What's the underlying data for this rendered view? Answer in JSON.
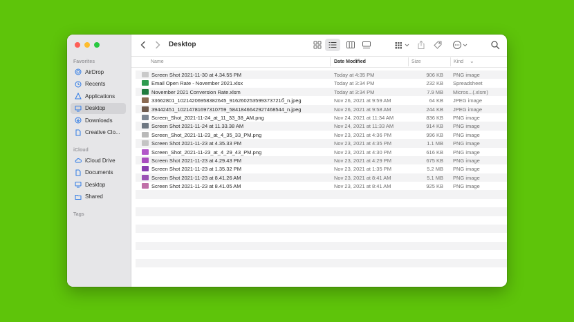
{
  "window": {
    "title": "Desktop"
  },
  "sidebar": {
    "sections": [
      {
        "label": "Favorites",
        "items": [
          {
            "label": "AirDrop",
            "icon": "airdrop-icon"
          },
          {
            "label": "Recents",
            "icon": "clock-icon"
          },
          {
            "label": "Applications",
            "icon": "applications-icon"
          },
          {
            "label": "Desktop",
            "icon": "desktop-icon",
            "active": true
          },
          {
            "label": "Downloads",
            "icon": "download-icon"
          },
          {
            "label": "Creative Clo...",
            "icon": "document-icon"
          }
        ]
      },
      {
        "label": "iCloud",
        "items": [
          {
            "label": "iCloud Drive",
            "icon": "cloud-icon"
          },
          {
            "label": "Documents",
            "icon": "document-icon"
          },
          {
            "label": "Desktop",
            "icon": "desktop-icon"
          },
          {
            "label": "Shared",
            "icon": "shared-folder-icon"
          }
        ]
      },
      {
        "label": "Tags",
        "items": []
      }
    ]
  },
  "columns": {
    "name": "Name",
    "date": "Date Modified",
    "size": "Size",
    "kind": "Kind"
  },
  "files": [
    {
      "name": "Screen Shot 2021-11-30 at 4.34.55 PM",
      "date": "Today at 4:35 PM",
      "size": "906 KB",
      "kind": "PNG image",
      "icon_color": "#c9c9c9"
    },
    {
      "name": "Email Open Rate - November 2021.xlsx",
      "date": "Today at 3:34 PM",
      "size": "232 KB",
      "kind": "Spreadsheet",
      "icon_color": "#2e9a4f"
    },
    {
      "name": "November 2021 Conversion Rate.xlsm",
      "date": "Today at 3:34 PM",
      "size": "7.9 MB",
      "kind": "Micros...(.xlsm)",
      "icon_color": "#1f7a3d"
    },
    {
      "name": "33662801_10214206958382645_916260253599373721б_n.jpeg",
      "date": "Nov 26, 2021 at 9:59 AM",
      "size": "64 KB",
      "kind": "JPEG image",
      "icon_color": "#8a6a52"
    },
    {
      "name": "39442451_10214781697310759_5841846642927468544_n.jpeg",
      "date": "Nov 26, 2021 at 9:58 AM",
      "size": "244 KB",
      "kind": "JPEG image",
      "icon_color": "#6f5b4e"
    },
    {
      "name": "Screen_Shot_2021-11-24_at_11_33_38_AM.png",
      "date": "Nov 24, 2021 at 11:34 AM",
      "size": "836 KB",
      "kind": "PNG image",
      "icon_color": "#7d8793"
    },
    {
      "name": "Screen Shot 2021-11-24 at 11.33.38 AM",
      "date": "Nov 24, 2021 at 11:33 AM",
      "size": "914 KB",
      "kind": "PNG image",
      "icon_color": "#6d7781"
    },
    {
      "name": "Screen_Shot_2021-11-23_at_4_35_33_PM.png",
      "date": "Nov 23, 2021 at 4:36 PM",
      "size": "996 KB",
      "kind": "PNG image",
      "icon_color": "#b9b9b9"
    },
    {
      "name": "Screen Shot 2021-11-23 at 4.35.33 PM",
      "date": "Nov 23, 2021 at 4:35 PM",
      "size": "1.1 MB",
      "kind": "PNG image",
      "icon_color": "#c4c4c4"
    },
    {
      "name": "Screen_Shot_2021-11-23_at_4_29_43_PM.png",
      "date": "Nov 23, 2021 at 4:30 PM",
      "size": "616 KB",
      "kind": "PNG image",
      "icon_color": "#b256c9"
    },
    {
      "name": "Screen Shot 2021-11-23 at 4.29.43 PM",
      "date": "Nov 23, 2021 at 4:29 PM",
      "size": "675 KB",
      "kind": "PNG image",
      "icon_color": "#a94dbf"
    },
    {
      "name": "Screen Shot 2021-11-23 at 1.35.32 PM",
      "date": "Nov 23, 2021 at 1:35 PM",
      "size": "5.2 MB",
      "kind": "PNG image",
      "icon_color": "#8a3fb0"
    },
    {
      "name": "Screen Shot 2021-11-23 at 8.41.26 AM",
      "date": "Nov 23, 2021 at 8:41 AM",
      "size": "5.1 MB",
      "kind": "PNG image",
      "icon_color": "#9a52b5"
    },
    {
      "name": "Screen Shot 2021-11-23 at 8.41.05 AM",
      "date": "Nov 23, 2021 at 8:41 AM",
      "size": "925 KB",
      "kind": "PNG image",
      "icon_color": "#c06fa8"
    }
  ],
  "empty_row_count": 10
}
